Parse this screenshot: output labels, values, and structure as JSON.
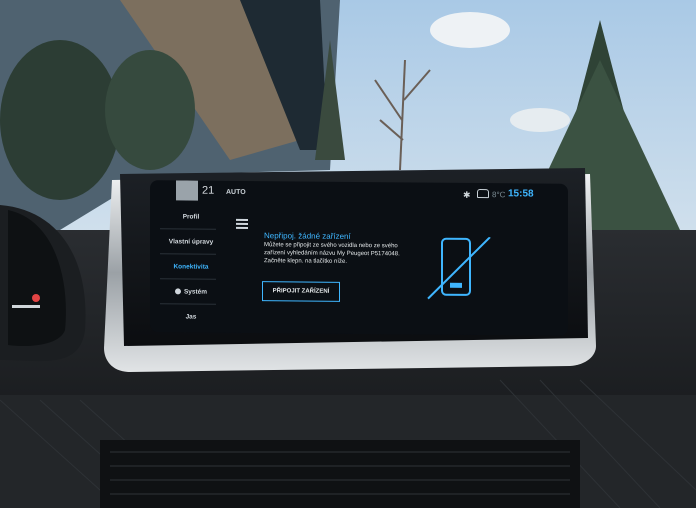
{
  "topbar": {
    "temperature": "21",
    "mode": "AUTO",
    "outside_temp": "8°C",
    "clock": "15:58"
  },
  "sidebar": {
    "items": [
      {
        "label": "Profil",
        "active": false
      },
      {
        "label": "Vlastní úpravy",
        "active": false
      },
      {
        "label": "Konektivita",
        "active": true
      },
      {
        "label": "Systém",
        "active": false
      },
      {
        "label": "Jas",
        "active": false
      }
    ]
  },
  "main": {
    "title": "Nepřipoj. žádné zařízení",
    "description": "Můžete se připojit ze svého vozidla nebo ze svého zařízení vyhledáním názvu My Peugeot P5174048. Začněte klepn. na tlačítko níže.",
    "connect_button": "PŘIPOJIT ZAŘÍZENÍ"
  },
  "colors": {
    "accent": "#3fb6ff",
    "screen_bg": "#0b0f14"
  },
  "icons": [
    "menu-icon",
    "bluetooth-icon",
    "car-icon",
    "phone-disconnected-icon"
  ]
}
